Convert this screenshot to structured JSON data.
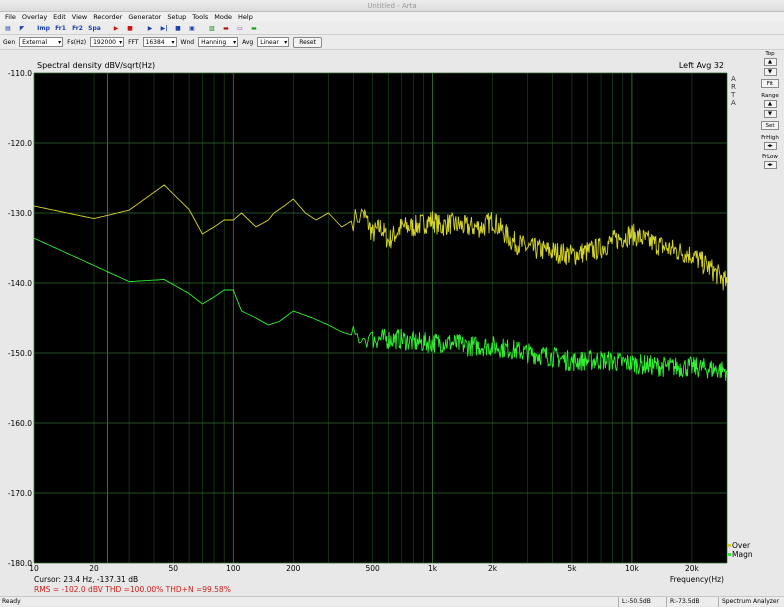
{
  "window": {
    "title": "Untitled - Arta"
  },
  "menu": [
    "File",
    "Overlay",
    "Edit",
    "View",
    "Recorder",
    "Generator",
    "Setup",
    "Tools",
    "Mode",
    "Help"
  ],
  "toolbar": {
    "icons": [
      "open-icon",
      "pointer-icon",
      "imp-icon",
      "fr1-icon",
      "fr2-icon",
      "spa-icon",
      "play-icon",
      "stop-icon",
      "run-icon",
      "step-icon",
      "rec-icon",
      "gen-icon",
      "wave-icon",
      "status-icon"
    ],
    "labels": {
      "imp": "Imp",
      "fr1": "Fr1",
      "fr2": "Fr2",
      "spa": "Spa"
    }
  },
  "controls": {
    "gen_label": "Gen",
    "gen_value": "External",
    "fs_label": "Fs(Hz)",
    "fs_value": "192000",
    "fft_label": "FFT",
    "fft_value": "16384",
    "wnd_label": "Wnd",
    "wnd_value": "Hanning",
    "avg_label": "Avg",
    "avg_value": "Linear",
    "reset": "Reset"
  },
  "chart_data": {
    "type": "line",
    "title": "Spectral density dBV/sqrt(Hz)",
    "top_right": "Left  Avg 32",
    "brand": "A R T A",
    "xlabel": "Frequency(Hz)",
    "xscale": "log",
    "xlim": [
      10,
      30000
    ],
    "ylim": [
      -180,
      -110
    ],
    "yticks": [
      "-110.0",
      "-120.0",
      "-130.0",
      "-140.0",
      "-150.0",
      "-160.0",
      "-170.0",
      "-180.0"
    ],
    "ytick_values": [
      -110,
      -120,
      -130,
      -140,
      -150,
      -160,
      -170,
      -180
    ],
    "xticks": [
      "10",
      "20",
      "50",
      "100",
      "200",
      "500",
      "1k",
      "2k",
      "5k",
      "10k",
      "20k"
    ],
    "xtick_values": [
      10,
      20,
      50,
      100,
      200,
      500,
      1000,
      2000,
      5000,
      10000,
      20000
    ],
    "background": "#000000",
    "grid_color": "#2f6b2f",
    "series": [
      {
        "name": "Over",
        "color": "#d4d42a",
        "x": [
          10,
          20,
          30,
          45,
          60,
          70,
          80,
          90,
          100,
          110,
          130,
          150,
          160,
          180,
          200,
          230,
          260,
          300,
          350,
          400,
          450,
          500,
          550,
          600,
          700,
          800,
          900,
          1000,
          1100,
          1200,
          1500,
          1800,
          2000,
          2500,
          3000,
          4000,
          5000,
          6000,
          7000,
          8000,
          10000,
          12000,
          15000,
          20000,
          25000,
          30000
        ],
        "y": [
          -129,
          -130.8,
          -129.6,
          -126,
          -129.5,
          -133,
          -132,
          -131,
          -131,
          -130,
          -132,
          -131,
          -130,
          -129,
          -128,
          -130,
          -131,
          -130,
          -132,
          -131,
          -130,
          -133,
          -132,
          -134,
          -132,
          -132,
          -131.5,
          -131,
          -132,
          -131.5,
          -132,
          -132,
          -131,
          -134,
          -135,
          -135.5,
          -136,
          -135.5,
          -135,
          -134,
          -133,
          -134,
          -135,
          -136,
          -138,
          -140
        ]
      },
      {
        "name": "Magn",
        "color": "#33ee33",
        "x": [
          10,
          20,
          30,
          45,
          60,
          70,
          80,
          90,
          100,
          110,
          130,
          150,
          170,
          200,
          250,
          300,
          350,
          400,
          500,
          600,
          700,
          800,
          1000,
          1200,
          1500,
          2000,
          2500,
          3000,
          4000,
          5000,
          7000,
          10000,
          15000,
          20000,
          30000
        ],
        "y": [
          -133.6,
          -137.5,
          -139.8,
          -139.5,
          -141.5,
          -143,
          -142,
          -141,
          -141,
          -144,
          -145,
          -146,
          -145.5,
          -144,
          -145,
          -146,
          -147,
          -147.5,
          -148,
          -148,
          -148,
          -148.5,
          -148.5,
          -148.5,
          -149,
          -149,
          -149.5,
          -150,
          -150.5,
          -151.2,
          -151,
          -151.5,
          -152,
          -152,
          -152.5
        ]
      }
    ],
    "cursor_line": "Cursor:    23.4 Hz, -137.31 dB",
    "stats_line": "RMS = -102.0 dBV   THD =100.00%   THD+N =99.58%"
  },
  "side": {
    "top": "Top",
    "fit": "Fit",
    "range": "Range",
    "set": "Set",
    "frhigh": "FrHigh",
    "frlow": "FrLow"
  },
  "status": {
    "ready": "Ready",
    "left": "L:-50.5dB",
    "right": "R:-73.5dB",
    "mode": "Spectrum Analyzer"
  }
}
